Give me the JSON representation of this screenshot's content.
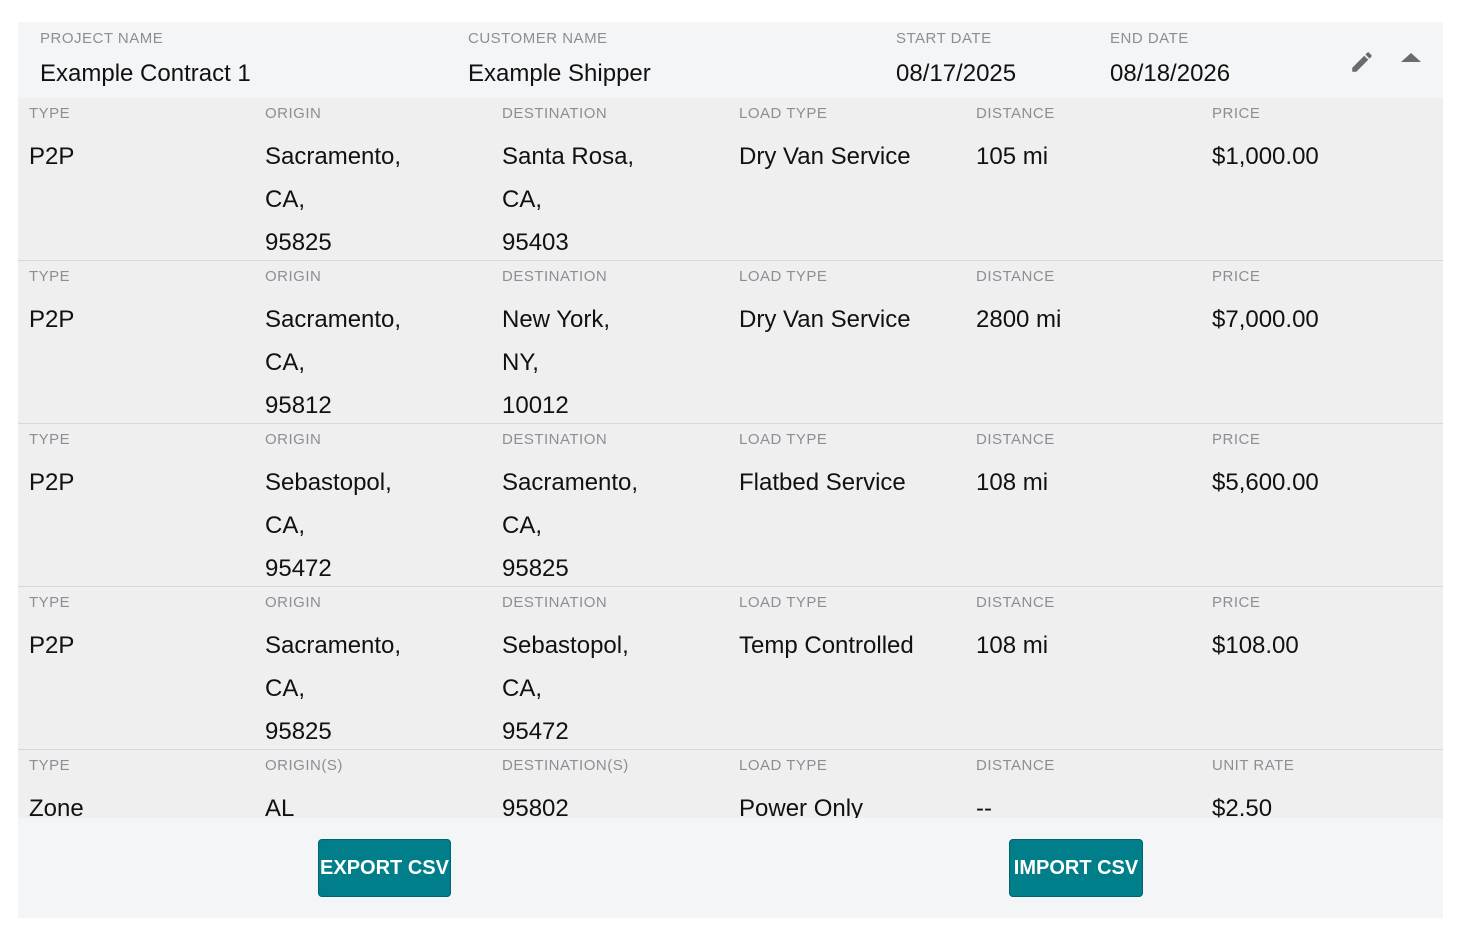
{
  "contract": {
    "project_name_label": "PROJECT NAME",
    "project_name": "Example Contract 1",
    "customer_name_label": "CUSTOMER NAME",
    "customer_name": "Example Shipper",
    "start_date_label": "START DATE",
    "start_date": "08/17/2025",
    "end_date_label": "END DATE",
    "end_date": "08/18/2026",
    "edit_icon": "pencil-icon",
    "collapse_icon": "caret-up-icon"
  },
  "lanes": [
    {
      "type_label": "TYPE",
      "type": "P2P",
      "origin_label": "ORIGIN",
      "origin": [
        "Sacramento,",
        "CA,",
        "95825"
      ],
      "destination_label": "DESTINATION",
      "destination": [
        "Santa Rosa,",
        "CA,",
        "95403"
      ],
      "load_type_label": "LOAD TYPE",
      "load_type": "Dry Van Service",
      "distance_label": "DISTANCE",
      "distance": "105 mi",
      "price_label": "PRICE",
      "price": "$1,000.00"
    },
    {
      "type_label": "TYPE",
      "type": "P2P",
      "origin_label": "ORIGIN",
      "origin": [
        "Sacramento,",
        "CA,",
        "95812"
      ],
      "destination_label": "DESTINATION",
      "destination": [
        "New York,",
        "NY,",
        "10012"
      ],
      "load_type_label": "LOAD TYPE",
      "load_type": "Dry Van Service",
      "distance_label": "DISTANCE",
      "distance": "2800 mi",
      "price_label": "PRICE",
      "price": "$7,000.00"
    },
    {
      "type_label": "TYPE",
      "type": "P2P",
      "origin_label": "ORIGIN",
      "origin": [
        "Sebastopol,",
        "CA,",
        "95472"
      ],
      "destination_label": "DESTINATION",
      "destination": [
        "Sacramento,",
        "CA,",
        "95825"
      ],
      "load_type_label": "LOAD TYPE",
      "load_type": "Flatbed Service",
      "distance_label": "DISTANCE",
      "distance": "108 mi",
      "price_label": "PRICE",
      "price": "$5,600.00"
    },
    {
      "type_label": "TYPE",
      "type": "P2P",
      "origin_label": "ORIGIN",
      "origin": [
        "Sacramento,",
        "CA,",
        "95825"
      ],
      "destination_label": "DESTINATION",
      "destination": [
        "Sebastopol,",
        "CA,",
        "95472"
      ],
      "load_type_label": "LOAD TYPE",
      "load_type": "Temp Controlled",
      "distance_label": "DISTANCE",
      "distance": "108 mi",
      "price_label": "PRICE",
      "price": "$108.00"
    },
    {
      "type_label": "TYPE",
      "type": "Zone",
      "origin_label": "ORIGIN(S)",
      "origin": [
        "AL"
      ],
      "destination_label": "DESTINATION(S)",
      "destination": [
        "95802"
      ],
      "load_type_label": "LOAD TYPE",
      "load_type": "Power Only",
      "distance_label": "DISTANCE",
      "distance": "--",
      "price_label": "UNIT RATE",
      "price": "$2.50"
    }
  ],
  "actions": {
    "export_label": "EXPORT CSV",
    "import_label": "IMPORT CSV"
  },
  "colors": {
    "accent": "#007e8a",
    "label_gray": "#8a8f96",
    "card_bg": "#f4f5f7",
    "row_bg": "#efefef"
  }
}
